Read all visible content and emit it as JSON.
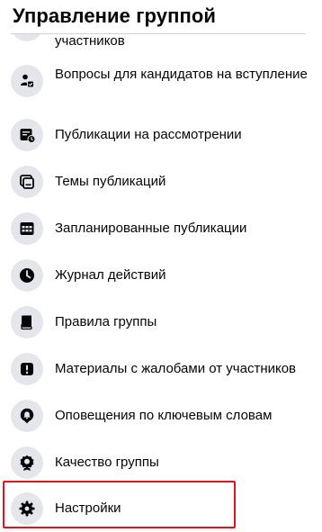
{
  "header": {
    "title": "Управление группой"
  },
  "items": [
    {
      "label": "участников",
      "icon": "members-icon"
    },
    {
      "label": "Вопросы для кандидатов на вступление",
      "icon": "member-questions-icon"
    },
    {
      "label": "Публикации на рассмотрении",
      "icon": "pending-posts-icon"
    },
    {
      "label": "Темы публикаций",
      "icon": "post-topics-icon"
    },
    {
      "label": "Запланированные публикации",
      "icon": "calendar-icon"
    },
    {
      "label": "Журнал действий",
      "icon": "clock-icon"
    },
    {
      "label": "Правила группы",
      "icon": "book-icon"
    },
    {
      "label": "Материалы с жалобами от участников",
      "icon": "report-icon"
    },
    {
      "label": "Оповещения по ключевым словам",
      "icon": "bell-alert-icon"
    },
    {
      "label": "Качество группы",
      "icon": "quality-badge-icon"
    },
    {
      "label": "Настройки",
      "icon": "gear-icon"
    }
  ],
  "colors": {
    "highlight": "#e0141e",
    "icon_bg": "#e4e6eb",
    "icon_fg": "#050505"
  }
}
